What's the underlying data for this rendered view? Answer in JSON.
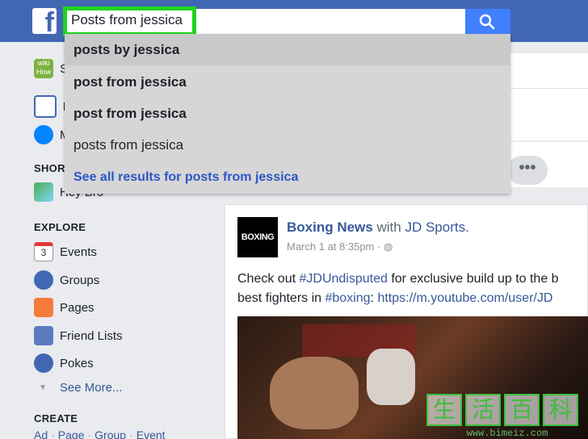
{
  "search": {
    "query": "Posts from jessica",
    "suggestions": [
      {
        "label": "posts by jessica",
        "bold": true,
        "active": true
      },
      {
        "label": "post from jessica",
        "bold": true
      },
      {
        "label": "post from jessica",
        "bold": true
      },
      {
        "label": "posts from jessica",
        "bold": false
      }
    ],
    "see_all": "See all results for posts from jessica"
  },
  "brand": {
    "logo_letter": "f",
    "accent": "#4267b2",
    "highlight": "#1fd51f"
  },
  "sidebar": {
    "wikihow_item": "S",
    "news_item": "N",
    "messenger_item": "M",
    "shortcuts_head": "SHOR",
    "shortcut_item": "Hey Bro",
    "explore_head": "EXPLORE",
    "explore_items": [
      "Events",
      "Groups",
      "Pages",
      "Friend Lists",
      "Pokes"
    ],
    "calendar_day": "3",
    "see_more": "See More...",
    "create_head": "CREATE",
    "create_links": [
      "Ad",
      "Page",
      "Group",
      "Event"
    ]
  },
  "post": {
    "avatar_text": "BOXING",
    "author": "Boxing News",
    "with_text": "with",
    "with_page": "JD Sports.",
    "meta": "March 1 at 8:35pm · ",
    "line1_prefix": "Check out ",
    "line1_tag": "#JDUndisputed",
    "line1_suffix": " for exclusive build up to the b",
    "line2_prefix": "best fighters in ",
    "line2_tag": "#boxing",
    "line2_mid": ": ",
    "line2_link": "https://m.youtube.com/user/JD"
  },
  "more_button": "•••",
  "watermark": {
    "chars": [
      "生",
      "活",
      "百",
      "科"
    ],
    "url": "www.bimeiz.com"
  }
}
